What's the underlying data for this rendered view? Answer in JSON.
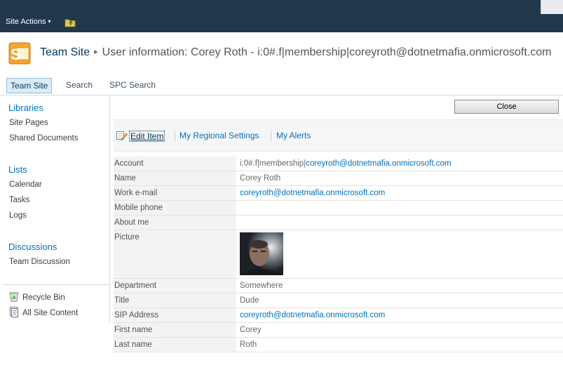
{
  "ribbon": {
    "site_actions_label": "Site Actions",
    "site_actions_caret": "▾",
    "folder_icon": "folder-up-icon"
  },
  "title": {
    "site_name": "Team Site",
    "separator": "▸",
    "page_title": "User information: Corey Roth - i:0#.f|membership|coreyroth@dotnetmafia.onmicrosoft.com"
  },
  "topnav": {
    "tabs": [
      {
        "label": "Team Site",
        "active": true
      },
      {
        "label": "Search",
        "active": false
      },
      {
        "label": "SPC Search",
        "active": false
      }
    ]
  },
  "leftnav": {
    "libraries": {
      "header": "Libraries",
      "items": [
        "Site Pages",
        "Shared Documents"
      ]
    },
    "lists": {
      "header": "Lists",
      "items": [
        "Calendar",
        "Tasks",
        "Logs"
      ]
    },
    "discussions": {
      "header": "Discussions",
      "items": [
        "Team Discussion"
      ]
    },
    "utility": [
      {
        "label": "Recycle Bin",
        "icon": "recycle-bin-icon"
      },
      {
        "label": "All Site Content",
        "icon": "site-content-icon"
      }
    ]
  },
  "main": {
    "close_label": "Close",
    "actions": {
      "edit_item": "Edit Item",
      "regional_settings": "My Regional Settings",
      "alerts": "My Alerts"
    },
    "fields": [
      {
        "label": "Account",
        "value_prefix": "i:0#.f|membership|",
        "value_link": "coreyroth@dotnetmafia.onmicrosoft.com"
      },
      {
        "label": "Name",
        "value": "Corey Roth"
      },
      {
        "label": "Work e-mail",
        "value_link": "coreyroth@dotnetmafia.onmicrosoft.com"
      },
      {
        "label": "Mobile phone",
        "value": ""
      },
      {
        "label": "About me",
        "value": ""
      },
      {
        "label": "Picture",
        "value": ""
      },
      {
        "label": "Department",
        "value": "Somewhere"
      },
      {
        "label": "Title",
        "value": "Dude"
      },
      {
        "label": "SIP Address",
        "value_link": "coreyroth@dotnetmafia.onmicrosoft.com"
      },
      {
        "label": "First name",
        "value": "Corey"
      },
      {
        "label": "Last name",
        "value": "Roth"
      }
    ]
  },
  "colors": {
    "ribbon_bg": "#21374c",
    "link": "#0072bc",
    "nav_header": "#0072bc",
    "label_bg": "#f3f3f3"
  }
}
